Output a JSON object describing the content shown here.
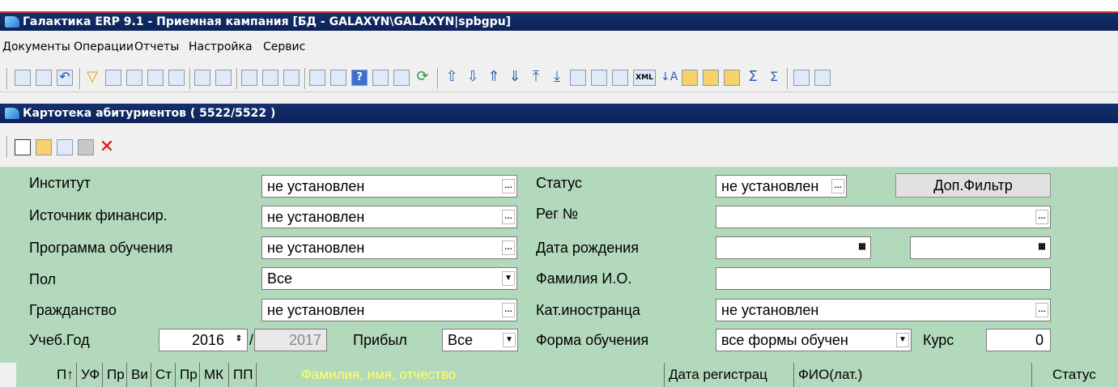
{
  "window": {
    "title": "Галактика ERP 9.1 - Приемная кампания [БД - GALAXYN\\GALAXYN|spbgpu]"
  },
  "menu": [
    "Документы",
    "Операции",
    "Отчеты",
    "Настройка",
    "Сервис"
  ],
  "subwindow": {
    "title": "Картотека абитуриентов ( 5522/5522 )"
  },
  "form": {
    "institute": {
      "label": "Институт",
      "value": "не установлен"
    },
    "funding": {
      "label": "Источник финансир.",
      "value": "не установлен"
    },
    "program": {
      "label": "Программа обучения",
      "value": "не установлен"
    },
    "gender": {
      "label": "Пол",
      "value": "Все"
    },
    "citizenship": {
      "label": "Гражданство",
      "value": "не установлен"
    },
    "study_year": {
      "label": "Учеб.Год",
      "from": "2016",
      "to": "2017",
      "sep": "/"
    },
    "arrived": {
      "label": "Прибыл",
      "value": "Все"
    },
    "status": {
      "label": "Статус",
      "value": "не установлен"
    },
    "extra_filter_button": "Доп.Фильтр",
    "reg_no": {
      "label": "Рег №",
      "value": ""
    },
    "birth_date": {
      "label": "Дата рождения",
      "from": "",
      "to": ""
    },
    "fio": {
      "label": "Фамилия И.О.",
      "value": ""
    },
    "foreign_cat": {
      "label": "Кат.иностранца",
      "value": "не установлен"
    },
    "study_form": {
      "label": "Форма обучения",
      "value": "все формы обучен"
    },
    "course": {
      "label": "Курс",
      "value": "0"
    }
  },
  "grid": {
    "columns": [
      "П↑",
      "УФ",
      "Пр",
      "Ви",
      "Ст",
      "Пр",
      "МК",
      "ПП",
      "Фамилия, имя, отчество",
      "Дата регистрац",
      "ФИО(лат.)",
      "Статус"
    ]
  },
  "colors": {
    "title_bg": "#0d2258",
    "form_bg": "#b3d9bd",
    "name_header": "#ffff66"
  }
}
